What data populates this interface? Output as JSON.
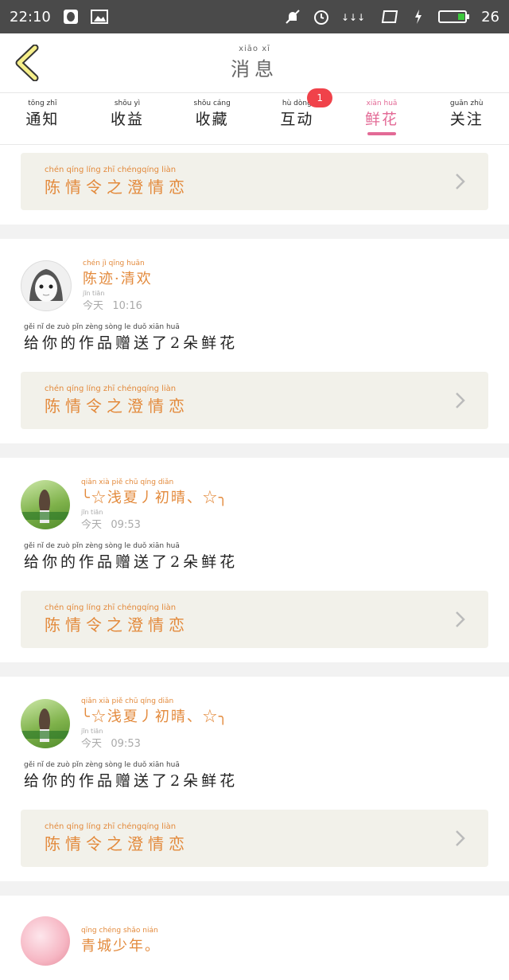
{
  "status_bar": {
    "time": "22:10",
    "battery": "26"
  },
  "header": {
    "title_pinyin": "xiāo  xī",
    "title": "消息"
  },
  "tabs": [
    {
      "pinyin": "tōng  zhī",
      "label": "通知"
    },
    {
      "pinyin": "shōu  yì",
      "label": "收益"
    },
    {
      "pinyin": "shōu cáng",
      "label": "收藏"
    },
    {
      "pinyin": "hù  dòng",
      "label": "互动",
      "badge": "1"
    },
    {
      "pinyin": "xiān  huā",
      "label": "鲜花",
      "active": true
    },
    {
      "pinyin": "guān  zhù",
      "label": "关注"
    }
  ],
  "work": {
    "pinyin": "chén qíng líng  zhī chéngqíng liàn",
    "title": "陈情令之澄情恋"
  },
  "entries": [
    {
      "user_pinyin": "chén  jì    qīng huān",
      "user": "陈迹·清欢",
      "day_pinyin": "jīn  tiān",
      "day": "今天",
      "time": "10:16",
      "msg_pinyin": "gěi  nǐ  de  zuò  pǐn  zèng sòng  le    duǒ  xiān huā",
      "msg": "给你的作品赠送了2朵鲜花",
      "work_pinyin": "chén qíng líng  zhī chéngqíng liàn",
      "work": "陈情令之澄情恋"
    },
    {
      "user_pinyin": "qiǎn  xià  piě  chū qíng diǎn",
      "user": "╰☆浅夏丿初晴、☆╮",
      "day_pinyin": "jīn  tiān",
      "day": "今天",
      "time": "09:53",
      "msg_pinyin": "gěi  nǐ  de  zuò  pǐn  zèng sòng  le    duǒ  xiān huā",
      "msg": "给你的作品赠送了2朵鲜花",
      "work_pinyin": "chén qíng líng  zhī chéngqíng liàn",
      "work": "陈情令之澄情恋"
    },
    {
      "user_pinyin": "qiǎn  xià  piě  chū qíng diǎn",
      "user": "╰☆浅夏丿初晴、☆╮",
      "day_pinyin": "jīn  tiān",
      "day": "今天",
      "time": "09:53",
      "msg_pinyin": "gěi  nǐ  de  zuò  pǐn  zèng sòng  le    duǒ  xiān huā",
      "msg": "给你的作品赠送了2朵鲜花",
      "work_pinyin": "chén qíng líng  zhī chéngqíng liàn",
      "work": "陈情令之澄情恋"
    },
    {
      "user_pinyin": "qīng chéng shǎo nián",
      "user": "青城少年。"
    }
  ]
}
